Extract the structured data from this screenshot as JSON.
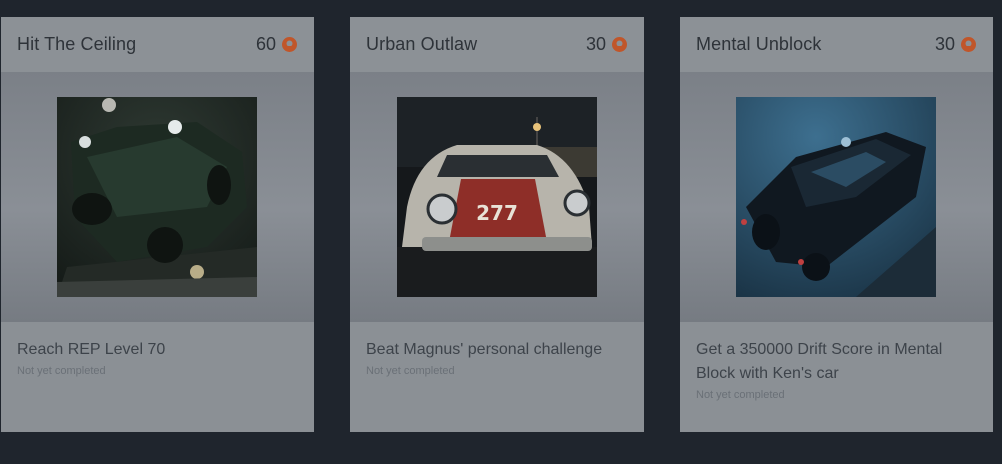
{
  "achievements": [
    {
      "title": "Hit The Ceiling",
      "points": "60",
      "description": "Reach REP Level 70",
      "status": "Not yet completed",
      "icon": "gamerscore-icon"
    },
    {
      "title": "Urban Outlaw",
      "points": "30",
      "description": "Beat Magnus' personal challenge",
      "status": "Not yet completed",
      "icon": "gamerscore-icon",
      "plate": "277"
    },
    {
      "title": "Mental Unblock",
      "points": "30",
      "description": "Get a 350000 Drift Score in Mental Block with Ken's car",
      "status": "Not yet completed",
      "icon": "gamerscore-icon"
    }
  ],
  "colors": {
    "background": "#1f252d",
    "card": "#8b9095",
    "accent": "#c0562a"
  }
}
